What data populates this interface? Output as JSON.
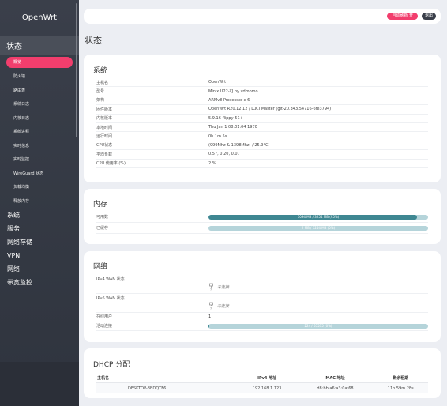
{
  "sidebar": {
    "brand": "OpenWrt",
    "status_section": "状态",
    "status_items": [
      "概览",
      "防火墙",
      "路由表",
      "系统日志",
      "内核日志",
      "系统进程",
      "实时信息",
      "实时监控",
      "WireGuard 状态",
      "负载均衡",
      "释放内存"
    ],
    "categories": [
      "系统",
      "服务",
      "网络存储",
      "VPN",
      "网络",
      "带宽监控"
    ]
  },
  "topbar": {
    "autorefresh_label": "自动刷新 开",
    "logout_label": "退出"
  },
  "page_title": "状态",
  "system": {
    "title": "系统",
    "rows": [
      {
        "k": "主机名",
        "v": "OpenWrt"
      },
      {
        "k": "型号",
        "v": "Minix U22-XJ by vdmomo"
      },
      {
        "k": "架构",
        "v": "ARMv8 Processor x 6"
      },
      {
        "k": "固件版本",
        "v": "OpenWrt R20.12.12 / LuCI Master (git-20.343.54716-6fe3794)"
      },
      {
        "k": "内核版本",
        "v": "5.9.16-flippy-51+"
      },
      {
        "k": "本地时间",
        "v": "Thu Jan 1 08:01:04 1970"
      },
      {
        "k": "运行时间",
        "v": "0h 1m 5s"
      },
      {
        "k": "CPU状态",
        "v": "(999Mhz & 1398Mhz) / 25.9°C"
      },
      {
        "k": "平均负载",
        "v": "0.57, 0.20, 0.07"
      },
      {
        "k": "CPU 使用率 (%)",
        "v": "2 %"
      }
    ]
  },
  "memory": {
    "title": "内存",
    "rows": [
      {
        "k": "可用数",
        "bar_text": "3094 MB / 3254 MB (95%)",
        "fraction": 0.95
      },
      {
        "k": "已缓存",
        "bar_text": "2 MB / 3254 MB (0%)",
        "fraction": 0.0
      }
    ]
  },
  "network": {
    "title": "网络",
    "ipv4_label": "IPv4 WAN 状态",
    "ipv4_value": "未连接",
    "ipv6_label": "IPv6 WAN 状态",
    "ipv6_value": "未连接",
    "active_label": "在线用户",
    "active_value": "1",
    "conn_label": "活动连接",
    "conn_text": "224 / 65535 (0%)",
    "conn_fraction": 0.003
  },
  "dhcp": {
    "title": "DHCP 分配",
    "headers": [
      "主机名",
      "IPv4 地址",
      "MAC 地址",
      "剩余租期"
    ],
    "rows": [
      {
        "host": "DESKTOP-8BDQTF6",
        "ip": "192.168.1.123",
        "mac": "d8:bb:a6:a3:0a:68",
        "lease": "11h 59m 28s"
      }
    ]
  },
  "colors": {
    "accent": "#f23e6d",
    "sidebar": "#3a3f4a",
    "bar_fill": "#3e8792",
    "bar_bg": "#b5d4da"
  }
}
